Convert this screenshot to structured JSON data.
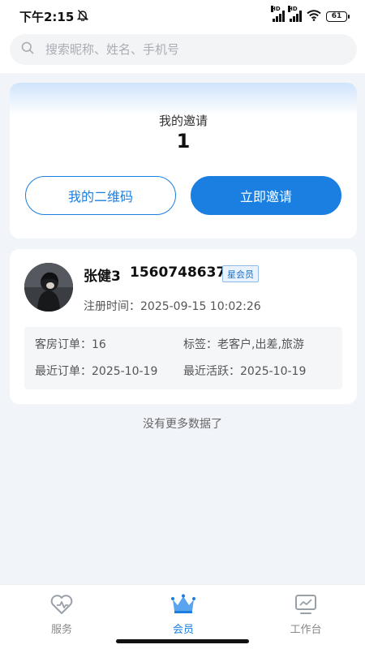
{
  "status_bar": {
    "time": "下午2:15",
    "battery": "61"
  },
  "search": {
    "placeholder": "搜索昵称、姓名、手机号"
  },
  "invite": {
    "title": "我的邀请",
    "count": "1",
    "qr_button": "我的二维码",
    "invite_button": "立即邀请"
  },
  "member": {
    "name": "张健3",
    "phone": "15607486378",
    "level": "星会员",
    "register_time": "注册时间：2025-09-15 10:02:26",
    "room_orders": "客房订单：16",
    "tags": "标签：老客户,出差,旅游",
    "recent_order": "最近订单：2025-10-19",
    "recent_active": "最近活跃：2025-10-19"
  },
  "no_more": "没有更多数据了",
  "bottom_nav": {
    "items": [
      {
        "label": "服务",
        "icon": "service-icon"
      },
      {
        "label": "会员",
        "icon": "crown-icon"
      },
      {
        "label": "工作台",
        "icon": "workbench-icon"
      }
    ],
    "active_index": 1
  },
  "colors": {
    "accent": "#1a7fe0",
    "page_bg": "#f1f4f8"
  }
}
